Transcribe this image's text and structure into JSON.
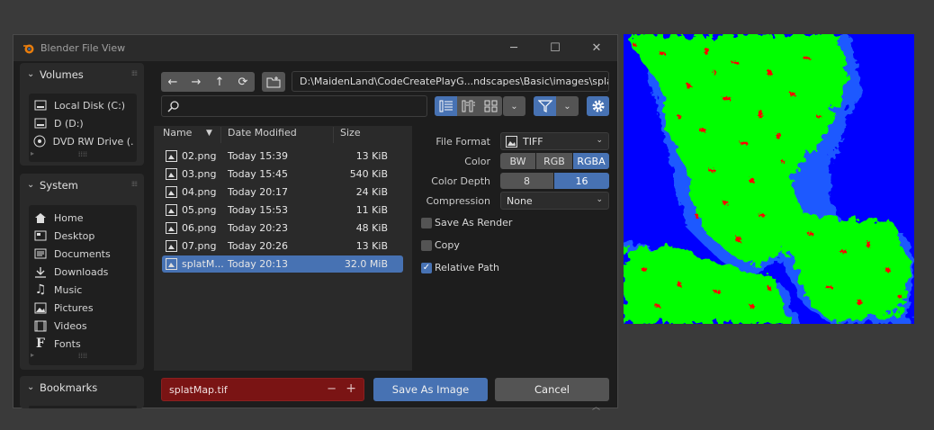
{
  "window": {
    "title": "Blender File View",
    "minimize": "─",
    "maximize": "☐",
    "close": "✕"
  },
  "sidebar": {
    "volumes": {
      "title": "Volumes",
      "items": [
        {
          "label": "Local Disk (C:)",
          "icon": "drive-icon"
        },
        {
          "label": "D (D:)",
          "icon": "drive-icon"
        },
        {
          "label": "DVD RW Drive (...",
          "icon": "disc-icon"
        }
      ]
    },
    "system": {
      "title": "System",
      "items": [
        {
          "label": "Home",
          "icon": "home-icon"
        },
        {
          "label": "Desktop",
          "icon": "desktop-icon"
        },
        {
          "label": "Documents",
          "icon": "documents-icon"
        },
        {
          "label": "Downloads",
          "icon": "download-icon"
        },
        {
          "label": "Music",
          "icon": "music-icon"
        },
        {
          "label": "Pictures",
          "icon": "pictures-icon"
        },
        {
          "label": "Videos",
          "icon": "videos-icon"
        },
        {
          "label": "Fonts",
          "icon": "font-icon"
        }
      ]
    },
    "bookmarks": {
      "title": "Bookmarks"
    }
  },
  "toolbar": {
    "back": "←",
    "forward": "→",
    "parent": "↑",
    "refresh": "⟳",
    "path": "D:\\MaidenLand\\CodeCreatePlayG...ndscapes\\Basic\\images\\splatMap\\"
  },
  "filelist": {
    "columns": {
      "name": "Name",
      "modified": "Date Modified",
      "size": "Size"
    },
    "sort_arrow": "▼",
    "rows": [
      {
        "name": "02.png",
        "modified": "Today 15:39",
        "size": "13 KiB",
        "selected": false
      },
      {
        "name": "03.png",
        "modified": "Today 15:45",
        "size": "540 KiB",
        "selected": false
      },
      {
        "name": "04.png",
        "modified": "Today 20:17",
        "size": "24 KiB",
        "selected": false
      },
      {
        "name": "05.png",
        "modified": "Today 15:53",
        "size": "11 KiB",
        "selected": false
      },
      {
        "name": "06.png",
        "modified": "Today 20:23",
        "size": "48 KiB",
        "selected": false
      },
      {
        "name": "07.png",
        "modified": "Today 20:26",
        "size": "13 KiB",
        "selected": false
      },
      {
        "name": "splatM...",
        "modified": "Today 20:13",
        "size": "32.0 MiB",
        "selected": true
      }
    ]
  },
  "options": {
    "file_format_label": "File Format",
    "file_format_value": "TIFF",
    "color_label": "Color",
    "color_options": [
      "BW",
      "RGB",
      "RGBA"
    ],
    "color_selected": "RGBA",
    "color_depth_label": "Color Depth",
    "color_depth_options": [
      "8",
      "16"
    ],
    "color_depth_selected": "16",
    "compression_label": "Compression",
    "compression_value": "None",
    "save_as_render_label": "Save As Render",
    "save_as_render_checked": false,
    "copy_label": "Copy",
    "copy_checked": false,
    "relative_path_label": "Relative Path",
    "relative_path_checked": true,
    "checkmark": "✓"
  },
  "footer": {
    "filename": "splatMap.tif",
    "minus": "−",
    "plus": "+",
    "save_label": "Save As Image",
    "cancel_label": "Cancel"
  },
  "colors": {
    "accent": "#4772b3",
    "filename_error_bg": "#7a1414",
    "preview_blue": "#0000ff",
    "preview_green": "#00ff00",
    "preview_red": "#ff0000"
  }
}
